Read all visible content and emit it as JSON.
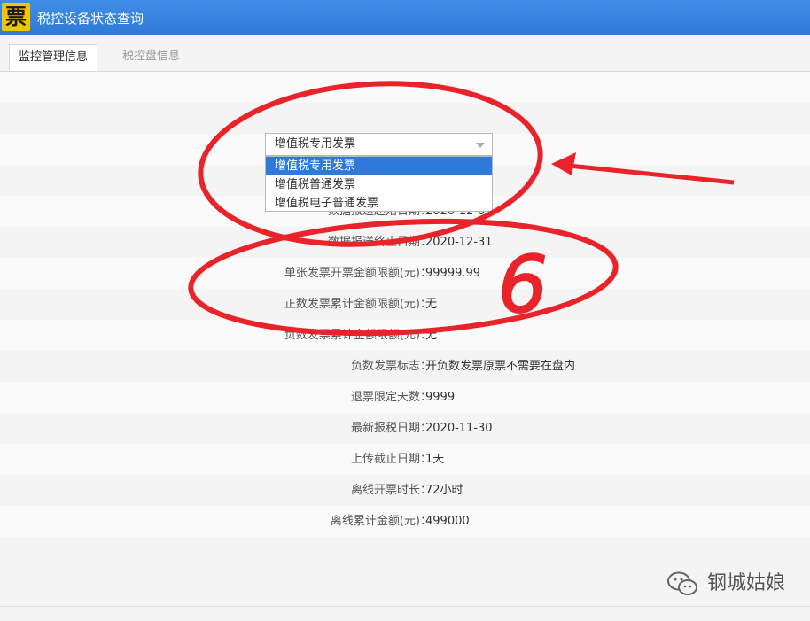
{
  "window": {
    "icon_glyph": "票",
    "title": "税控设备状态查询"
  },
  "tabs": [
    {
      "label": "监控管理信息",
      "active": true
    },
    {
      "label": "税控盘信息",
      "active": false
    }
  ],
  "invoice_type_select": {
    "value": "增值税专用发票",
    "options": [
      "增值税专用发票",
      "增值税普通发票",
      "增值税电子普通发票"
    ],
    "selected_index": 0
  },
  "rows": [
    {
      "label": "",
      "value": ""
    },
    {
      "label": "",
      "value": ""
    },
    {
      "label": "",
      "value": ""
    },
    {
      "label": "",
      "value": ""
    },
    {
      "label": "数据报送起始日期",
      "value": "2020-12-01"
    },
    {
      "label": "数据报送终止日期",
      "value": "2020-12-31"
    },
    {
      "label": "单张发票开票金额限额(元)",
      "value": "99999.99"
    },
    {
      "label": "正数发票累计金额限额(元)",
      "value": "无"
    },
    {
      "label": "负数发票累计金额限额(元)",
      "value": "无"
    },
    {
      "label": "负数发票标志",
      "value": "开负数发票原票不需要在盘内"
    },
    {
      "label": "退票限定天数",
      "value": "9999"
    },
    {
      "label": "最新报税日期",
      "value": "2020-11-30"
    },
    {
      "label": "上传截止日期",
      "value": "1天"
    },
    {
      "label": "离线开票时长",
      "value": "72小时"
    },
    {
      "label": "离线累计金额(元)",
      "value": "499000"
    },
    {
      "label": "",
      "value": ""
    }
  ],
  "annotation": {
    "handwritten_text": "6",
    "color": "#e8232a"
  },
  "watermark": {
    "icon": "wechat-icon",
    "text": "钢城姑娘"
  },
  "colors": {
    "title_bar": "#2f7ad8",
    "selected_option": "#2f7ad8",
    "annotation_red": "#e8232a"
  }
}
